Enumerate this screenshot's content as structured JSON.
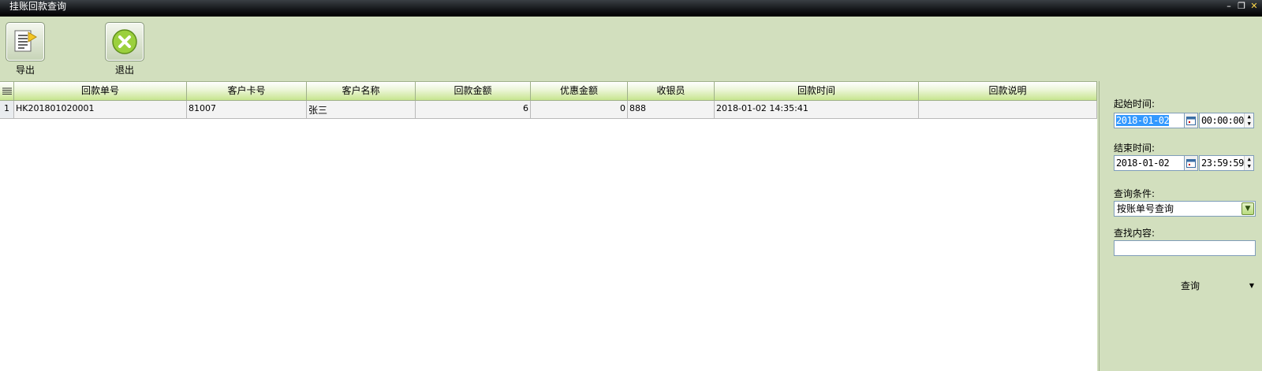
{
  "window": {
    "title": "挂账回款查询"
  },
  "toolbar": {
    "export_label": "导出",
    "exit_label": "退出"
  },
  "table": {
    "columns": [
      "回款单号",
      "客户卡号",
      "客户名称",
      "回款金额",
      "优惠金额",
      "收银员",
      "回款时间",
      "回款说明"
    ],
    "rows": [
      {
        "index": "1",
        "order_no": "HK201801020001",
        "card_no": "81007",
        "customer": "张三",
        "amount": "6",
        "discount": "0",
        "cashier": "888",
        "time": "2018-01-02 14:35:41",
        "note": ""
      }
    ]
  },
  "filters": {
    "start_label": "起始时间:",
    "start_date": "2018-01-02",
    "start_time": "00:00:00",
    "end_label": "结束时间:",
    "end_date": "2018-01-02",
    "end_time": "23:59:59",
    "condition_label": "查询条件:",
    "condition_value": "按账单号查询",
    "content_label": "查找内容:",
    "content_value": "",
    "query_label": "查询"
  }
}
